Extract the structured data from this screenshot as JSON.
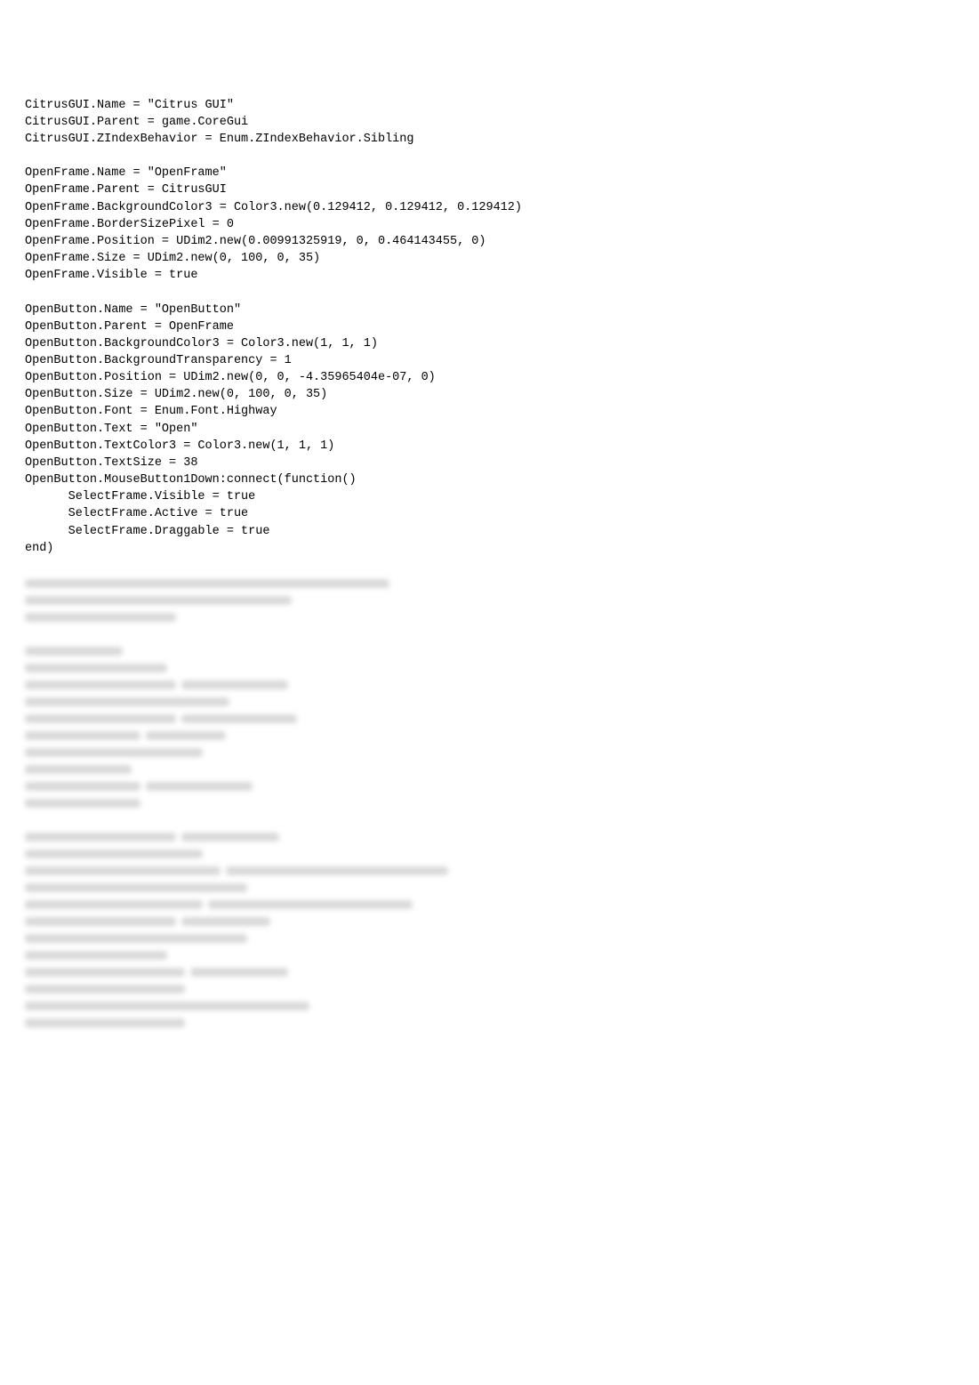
{
  "lines": [
    "CitrusGUI.Name = \"Citrus GUI\"",
    "CitrusGUI.Parent = game.CoreGui",
    "CitrusGUI.ZIndexBehavior = Enum.ZIndexBehavior.Sibling",
    "",
    "OpenFrame.Name = \"OpenFrame\"",
    "OpenFrame.Parent = CitrusGUI",
    "OpenFrame.BackgroundColor3 = Color3.new(0.129412, 0.129412, 0.129412)",
    "OpenFrame.BorderSizePixel = 0",
    "OpenFrame.Position = UDim2.new(0.00991325919, 0, 0.464143455, 0)",
    "OpenFrame.Size = UDim2.new(0, 100, 0, 35)",
    "OpenFrame.Visible = true",
    "",
    "OpenButton.Name = \"OpenButton\"",
    "OpenButton.Parent = OpenFrame",
    "OpenButton.BackgroundColor3 = Color3.new(1, 1, 1)",
    "OpenButton.BackgroundTransparency = 1",
    "OpenButton.Position = UDim2.new(0, 0, -4.35965404e-07, 0)",
    "OpenButton.Size = UDim2.new(0, 100, 0, 35)",
    "OpenButton.Font = Enum.Font.Highway",
    "OpenButton.Text = \"Open\"",
    "OpenButton.TextColor3 = Color3.new(1, 1, 1)",
    "OpenButton.TextSize = 38",
    "OpenButton.MouseButton1Down:connect(function()",
    "      SelectFrame.Visible = true",
    "      SelectFrame.Active = true",
    "      SelectFrame.Draggable = true",
    "end)",
    "",
    "SelectFrame.Name = \"SelectFrame\"",
    "SelectFrame.Parent = CitrusGUI",
    "SelectFrame.BackgroundColor3 = Color3.new(0.129412, 0.129412, 0.129412)",
    "SelectFrame.BorderSizePixel = 0"
  ],
  "blurred_rows": [
    [
      410,
      0,
      0
    ],
    [
      300,
      0,
      0
    ],
    [
      170,
      0,
      0
    ],
    [
      0,
      0,
      0
    ],
    [
      110,
      0,
      0
    ],
    [
      160,
      0,
      0
    ],
    [
      170,
      120,
      0
    ],
    [
      230,
      0,
      0
    ],
    [
      170,
      130,
      0
    ],
    [
      130,
      90,
      0
    ],
    [
      200,
      0,
      0
    ],
    [
      120,
      0,
      0
    ],
    [
      130,
      120,
      0
    ],
    [
      130,
      0,
      0
    ],
    [
      0,
      0,
      0
    ],
    [
      170,
      110,
      0
    ],
    [
      200,
      0,
      0
    ],
    [
      220,
      250,
      0
    ],
    [
      250,
      0,
      0
    ],
    [
      200,
      230,
      0
    ],
    [
      170,
      100,
      0
    ],
    [
      250,
      0,
      0
    ],
    [
      160,
      0,
      0
    ],
    [
      180,
      110,
      0
    ],
    [
      180,
      0,
      0
    ],
    [
      320,
      0,
      0
    ],
    [
      180,
      0,
      0
    ]
  ]
}
